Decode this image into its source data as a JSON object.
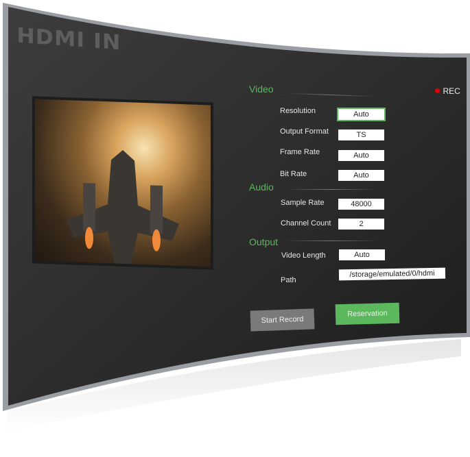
{
  "logo": "HDMI IN",
  "rec_label": "REC",
  "colors": {
    "accent": "#5bb85d",
    "rec": "#e60000",
    "panel": "#2e2e2e",
    "button_gray": "#7a7a7a"
  },
  "sections": {
    "video": "Video",
    "audio": "Audio",
    "output": "Output"
  },
  "video": [
    {
      "label": "Resolution",
      "value": "Auto",
      "selected": true
    },
    {
      "label": "Output Format",
      "value": "TS"
    },
    {
      "label": "Frame Rate",
      "value": "Auto"
    },
    {
      "label": "Bit Rate",
      "value": "Auto"
    }
  ],
  "audio": [
    {
      "label": "Sample Rate",
      "value": "48000"
    },
    {
      "label": "Channel Count",
      "value": "2"
    }
  ],
  "output": [
    {
      "label": "Video Length",
      "value": "Auto"
    },
    {
      "label": "Path",
      "value": "/storage/emulated/0/hdmi"
    }
  ],
  "buttons": {
    "start": "Start Record",
    "reservation": "Reservation"
  }
}
